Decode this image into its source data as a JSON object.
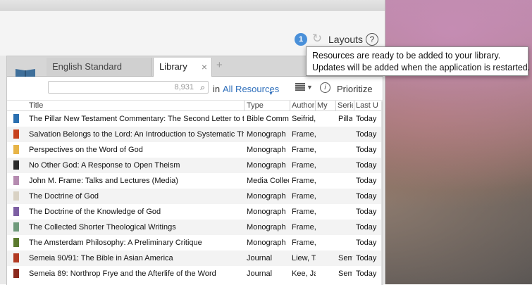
{
  "toolbar": {
    "badge_count": "1",
    "layouts_label": "Layouts",
    "help_label": "?"
  },
  "tooltip": {
    "line1": "Resources are ready to be added to your library.",
    "line2": "Updates will be added when the application is restarted."
  },
  "tabs": [
    {
      "label": "English Standard Version"
    },
    {
      "label": "Library",
      "close": "×"
    }
  ],
  "tab_add": "+",
  "search": {
    "count": "8,931",
    "in_label": "in",
    "scope": "All Resources",
    "prioritize_label": "Prioritize"
  },
  "table": {
    "headers": [
      "Title",
      "Type",
      "Author",
      "My",
      "Serie",
      "Last U"
    ],
    "rows": [
      {
        "title": "The Pillar New Testament Commentary: The Second Letter to the C...",
        "type": "Bible Comme",
        "author": "Seifrid,",
        "series": "Pillar",
        "last": "Today",
        "cover": "#2a6fb0"
      },
      {
        "title": "Salvation Belongs to the Lord: An Introduction to Systematic Theology",
        "type": "Monograph",
        "author": "Frame, .",
        "series": "",
        "last": "Today",
        "cover": "#c7421e"
      },
      {
        "title": "Perspectives on the Word of God",
        "type": "Monograph",
        "author": "Frame, .",
        "series": "",
        "last": "Today",
        "cover": "#e7b447"
      },
      {
        "title": "No Other God: A Response to Open Theism",
        "type": "Monograph",
        "author": "Frame, .",
        "series": "",
        "last": "Today",
        "cover": "#2b2b2b"
      },
      {
        "title": "John M. Frame: Talks and Lectures (Media)",
        "type": "Media Collect",
        "author": "Frame, .",
        "series": "",
        "last": "Today",
        "cover": "#b58bb0"
      },
      {
        "title": "The Doctrine of God",
        "type": "Monograph",
        "author": "Frame, .",
        "series": "",
        "last": "Today",
        "cover": "#d9d2c4"
      },
      {
        "title": "The Doctrine of the Knowledge of God",
        "type": "Monograph",
        "author": "Frame, .",
        "series": "",
        "last": "Today",
        "cover": "#7d5fa3"
      },
      {
        "title": "The Collected Shorter Theological Writings",
        "type": "Monograph",
        "author": "Frame, .",
        "series": "",
        "last": "Today",
        "cover": "#6f9a7b"
      },
      {
        "title": "The Amsterdam Philosophy: A Preliminary Critique",
        "type": "Monograph",
        "author": "Frame, .",
        "series": "",
        "last": "Today",
        "cover": "#5b7a2e"
      },
      {
        "title": "Semeia 90/91: The Bible in Asian America",
        "type": "Journal",
        "author": "Liew, Ta",
        "series": "Seme",
        "last": "Today",
        "cover": "#b23a22"
      },
      {
        "title": "Semeia 89: Northrop Frye and the Afterlife of the Word",
        "type": "Journal",
        "author": "Kee, Jar",
        "series": "Seme",
        "last": "Today",
        "cover": "#8b2a1e"
      }
    ]
  },
  "colors": {
    "accent": "#4a90d9",
    "link": "#2f6fbb"
  },
  "icons": [
    "sync-icon",
    "help-icon",
    "library-book-icon",
    "close-icon",
    "add-tab-icon",
    "search-icon",
    "grid-view-icon",
    "info-icon"
  ]
}
